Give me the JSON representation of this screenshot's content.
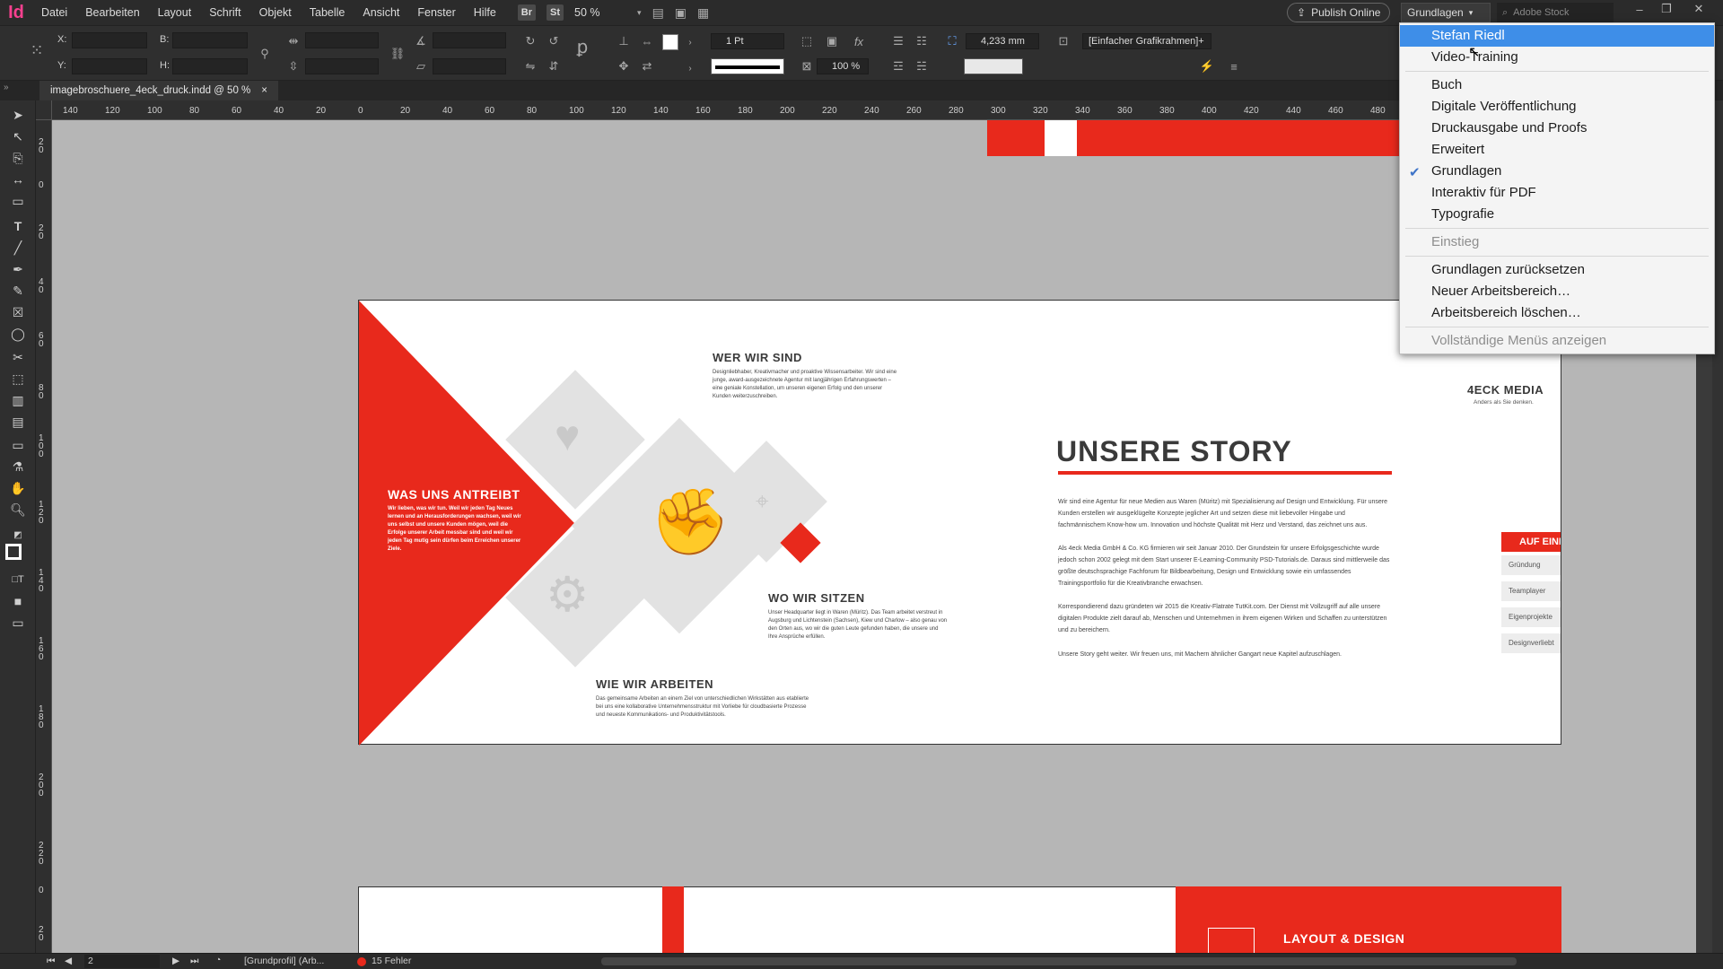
{
  "app": {
    "logo": "Id"
  },
  "menubar": {
    "items": [
      "Datei",
      "Bearbeiten",
      "Layout",
      "Schrift",
      "Objekt",
      "Tabelle",
      "Ansicht",
      "Fenster",
      "Hilfe"
    ],
    "bridge": "Br",
    "stock": "St",
    "zoom": "50 %",
    "publish_label": "Publish Online",
    "workspace_label": "Grundlagen",
    "search_placeholder": "Adobe Stock"
  },
  "controlbar": {
    "x_label": "X:",
    "y_label": "Y:",
    "b_label": "B:",
    "h_label": "H:",
    "stroke_weight": "1 Pt",
    "scale": "100 %",
    "offset": "4,233 mm",
    "object_style": "[Einfacher Grafikrahmen]+"
  },
  "tab": {
    "title": "imagebroschuere_4eck_druck.indd @ 50 %",
    "close": "×"
  },
  "ruler": {
    "h_ticks": [
      "140",
      "120",
      "100",
      "80",
      "60",
      "40",
      "20",
      "0",
      "20",
      "40",
      "60",
      "80",
      "100",
      "120",
      "140",
      "160",
      "180",
      "200",
      "220",
      "240",
      "260",
      "280",
      "300",
      "320",
      "340",
      "360",
      "380",
      "400",
      "420",
      "440",
      "460",
      "480"
    ],
    "v_ticks": [
      "20",
      "0",
      "20",
      "40",
      "60",
      "80",
      "100",
      "120",
      "140",
      "160",
      "180",
      "200",
      "220",
      "0",
      "20"
    ]
  },
  "doc": {
    "left": {
      "title": "WAS UNS ANTREIBT",
      "body": "Wir lieben, was wir tun. Weil wir jeden Tag Neues lernen und an Herausforderungen wachsen, weil wir uns selbst und unsere Kunden mögen, weil die Erfolge unserer Arbeit messbar sind und weil wir jeden Tag mutig sein dürfen beim Erreichen unserer Ziele."
    },
    "wer": {
      "title": "WER WIR SIND",
      "body": "Designliebhaber, Kreativmacher und proaktive Wissensarbeiter. Wir sind eine junge, award-ausgezeichnete Agentur mit langjährigen Erfahrungswerten – eine geniale Konstellation, um unseren eigenen Erfolg und den unserer Kunden weiterzuschreiben."
    },
    "wo": {
      "title": "WO WIR SITZEN",
      "body": "Unser Headquarter liegt in Waren (Müritz). Das Team arbeitet verstreut in Augsburg und Lichtenstein (Sachsen), Kiew und Charlow – also genau von den Orten aus, wo wir die guten Leute gefunden haben, die unsere und Ihre Ansprüche erfüllen."
    },
    "wie": {
      "title": "WIE WIR ARBEITEN",
      "body": "Das gemeinsame Arbeiten an einem Ziel von unterschiedlichen Wirkstätten aus etablierte bei uns eine kollaborative Unternehmensstruktur mit Vorliebe für cloudbasierte Prozesse und neueste Kommunikations- und Produktivitätstools."
    },
    "right": {
      "brand": "4ECK MEDIA",
      "tagline": "Anders als Sie denken.",
      "story_title": "UNSERE STORY",
      "p1": "Wir sind eine Agentur für neue Medien aus Waren (Müritz) mit Spezialisierung auf Design und Entwicklung. Für unsere Kunden erstellen wir ausgeklügelte Konzepte jeglicher Art und setzen diese mit liebevoller Hingabe und fachmännischem Know-how um. Innovation und höchste Qualität mit Herz und Verstand, das zeichnet uns aus.",
      "p2": "Als 4eck Media GmbH & Co. KG firmieren wir seit Januar 2010. Der Grundstein für unsere Erfolgsgeschichte wurde jedoch schon 2002 gelegt mit dem Start unserer E-Learning-Community PSD-Tutorials.de. Daraus sind mittlerweile das größte deutschsprachige Fachforum für Bildbearbeitung, Design und Entwicklung sowie ein umfassendes Trainingsportfolio für die Kreativbranche erwachsen.",
      "p3": "Korrespondierend dazu gründeten wir 2015 die Kreativ-Flatrate TutKit.com. Der Dienst mit Vollzugriff auf alle unsere digitalen Produkte zielt darauf ab, Menschen und Unternehmen in ihrem eigenen Wirken und Schaffen zu unterstützen und zu bereichern.",
      "p4": "Unsere Story geht weiter. Wir freuen uns, mit Machern ähnlicher Gangart neue Kapitel aufzuschlagen.",
      "glance": "AUF EINEN BLIC",
      "boxes": [
        "Gründung",
        "Teamplayer",
        "Eigenprojekte",
        "Designverliebt"
      ]
    },
    "bottom": {
      "label": "LAYOUT & DESIGN"
    }
  },
  "statusbar": {
    "page": "2",
    "profile": "[Grundprofil] (Arb...",
    "errors": "15 Fehler"
  },
  "workspace_menu": {
    "items": [
      {
        "label": "Stefan Riedl",
        "state": "highlighted"
      },
      {
        "label": "Video-Training",
        "state": "normal"
      },
      {
        "label": "Buch",
        "state": "normal"
      },
      {
        "label": "Digitale Veröffentlichung",
        "state": "normal"
      },
      {
        "label": "Druckausgabe und Proofs",
        "state": "normal"
      },
      {
        "label": "Erweitert",
        "state": "normal"
      },
      {
        "label": "Grundlagen",
        "state": "checked"
      },
      {
        "label": "Interaktiv für PDF",
        "state": "normal"
      },
      {
        "label": "Typografie",
        "state": "normal"
      },
      {
        "label": "Einstieg",
        "state": "disabled"
      },
      {
        "label": "Grundlagen zurücksetzen",
        "state": "normal"
      },
      {
        "label": "Neuer Arbeitsbereich…",
        "state": "normal"
      },
      {
        "label": "Arbeitsbereich löschen…",
        "state": "normal"
      },
      {
        "label": "Vollständige Menüs anzeigen",
        "state": "disabled"
      }
    ]
  },
  "colors": {
    "accent_red": "#e8291c",
    "highlight_blue": "#3e8ee8"
  }
}
